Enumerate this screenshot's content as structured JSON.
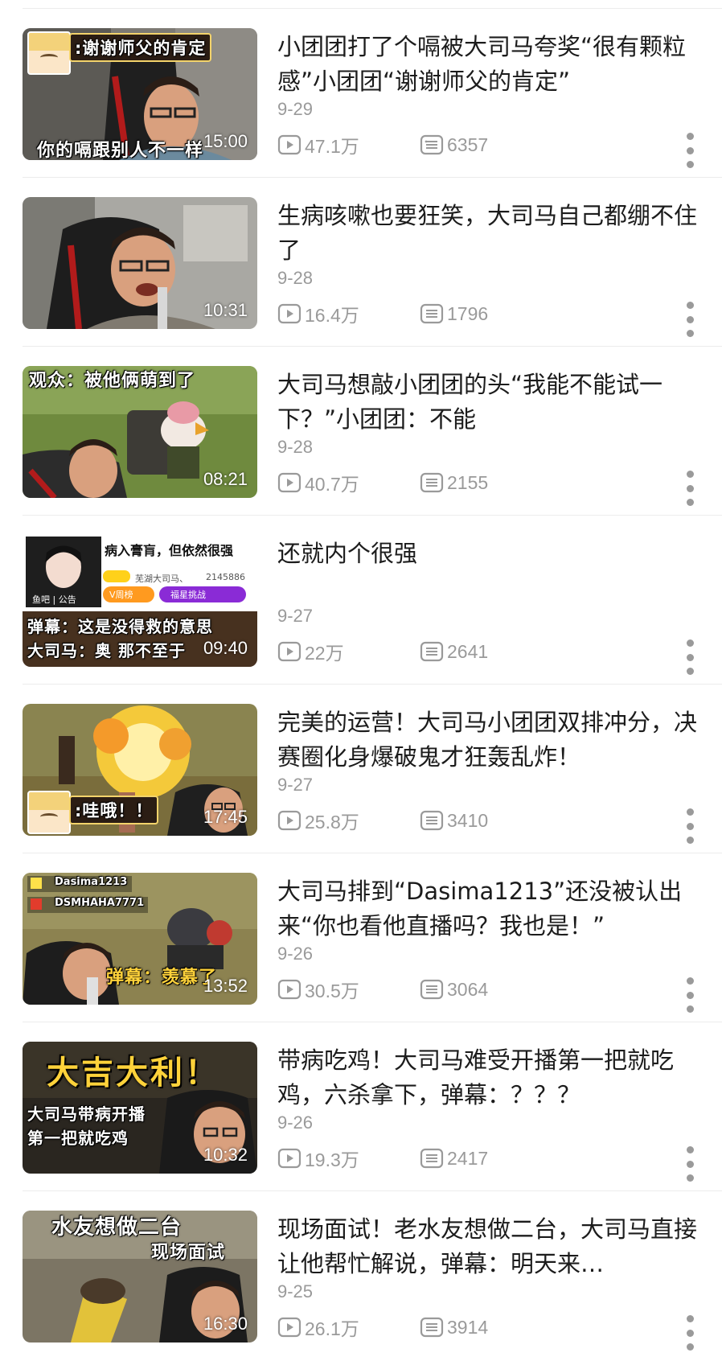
{
  "colors": {
    "title": "#1c1c1c",
    "meta": "#9a9a9a",
    "divider": "#ececec",
    "caption_yellow": "#ffd23a"
  },
  "icons": {
    "views": "play-count-icon",
    "danmaku": "danmaku-count-icon",
    "more": "more-vertical-icon"
  },
  "videos": [
    {
      "title": "小团团打了个嗝被大司马夸奖“很有颗粒感”小团团“谢谢师父的肯定”",
      "date": "9-29",
      "views": "47.1万",
      "danmaku": "6357",
      "duration": "15:00",
      "captions": [
        ":谢谢师父的肯定",
        "你的嗝跟别人不一样"
      ]
    },
    {
      "title": "生病咳嗽也要狂笑，大司马自己都绷不住了",
      "date": "9-28",
      "views": "16.4万",
      "danmaku": "1796",
      "duration": "10:31",
      "captions": []
    },
    {
      "title": "大司马想敲小团团的头“我能不能试一下？”小团团：不能",
      "date": "9-28",
      "views": "40.7万",
      "danmaku": "2155",
      "duration": "08:21",
      "captions": [
        "观众：被他俩萌到了"
      ]
    },
    {
      "title": "还就内个很强",
      "date": "9-27",
      "views": "22万",
      "danmaku": "2641",
      "duration": "09:40",
      "captions": [
        "病入膏肓，但依然很强",
        "芜湖大司马、",
        "2145886",
        "V周榜",
        "福星挑战",
        "鱼吧 | 公告",
        "弹幕：这是没得救的意思",
        "大司马：奥 那不至于"
      ]
    },
    {
      "title": "完美的运营！大司马小团团双排冲分，决赛圈化身爆破鬼才狂轰乱炸！",
      "date": "9-27",
      "views": "25.8万",
      "danmaku": "3410",
      "duration": "17:45",
      "captions": [
        ":哇哦！！"
      ]
    },
    {
      "title": "大司马排到“Dasima1213”还没被认出来“你也看他直播吗？我也是！”",
      "date": "9-26",
      "views": "30.5万",
      "danmaku": "3064",
      "duration": "13:52",
      "captions": [
        "Dasima1213",
        "DSMHAHA7771",
        "弹幕：羡慕了"
      ]
    },
    {
      "title": "带病吃鸡！大司马难受开播第一把就吃鸡，六杀拿下，弹幕：？？？",
      "date": "9-26",
      "views": "19.3万",
      "danmaku": "2417",
      "duration": "10:32",
      "captions": [
        "大吉大利！",
        "大司马带病开播",
        "第一把就吃鸡"
      ]
    },
    {
      "title": "现场面试！老水友想做二台，大司马直接让他帮忙解说，弹幕：明天来…",
      "date": "9-25",
      "views": "26.1万",
      "danmaku": "3914",
      "duration": "16:30",
      "captions": [
        "水友想做二台",
        "现场面试"
      ]
    }
  ]
}
